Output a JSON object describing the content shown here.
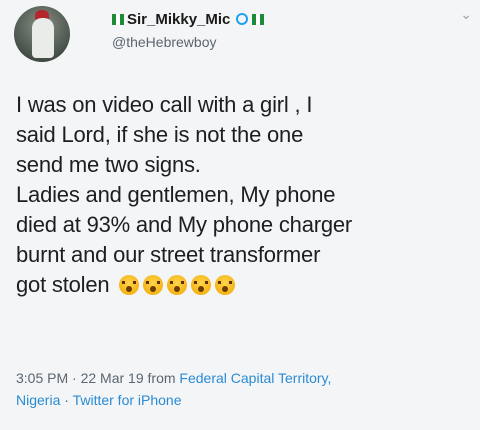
{
  "author": {
    "display_name": "Sir_Mikky_Mic",
    "handle": "@theHebrewboy"
  },
  "tweet": {
    "lines": [
      "I was on video call with a girl , I",
      "said Lord, if she is not the one",
      "send me two signs.",
      "Ladies and gentlemen, My phone",
      "died at 93% and My phone charger",
      "burnt and our street transformer",
      "got stolen"
    ],
    "emoji_count": 5
  },
  "meta": {
    "time": "3:05 PM",
    "date": "22 Mar 19",
    "from_prefix": "from",
    "location_part1": "Federal Capital Territory,",
    "location_part2": "Nigeria",
    "client": "Twitter for iPhone"
  },
  "colors": {
    "link": "#2a8bd4",
    "verified": "#1da1f2"
  },
  "icons": {
    "menu": "chevron-down-icon"
  }
}
